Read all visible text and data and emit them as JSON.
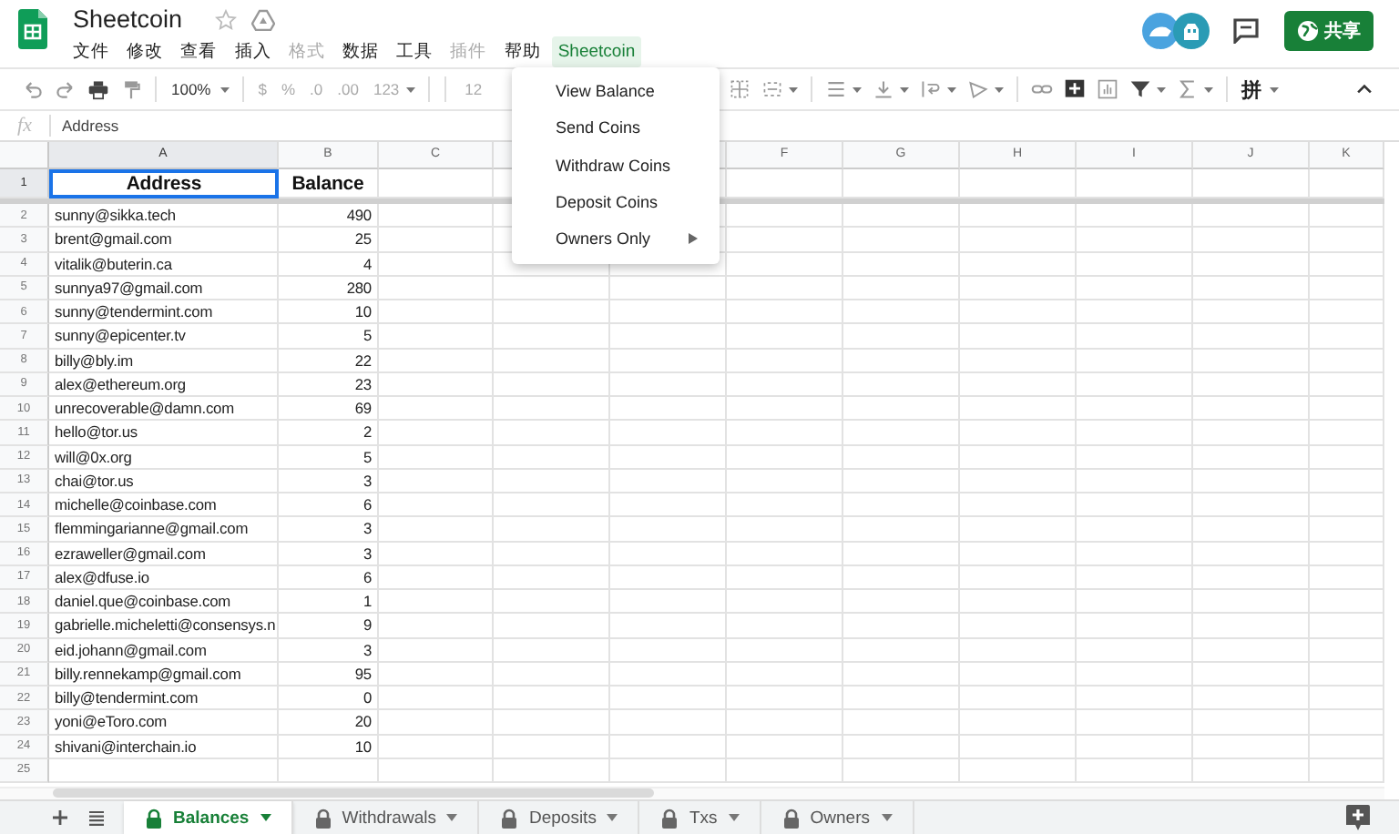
{
  "document": {
    "title": "Sheetcoin"
  },
  "menu_bar": [
    {
      "label": "文件",
      "disabled": false,
      "selected": false
    },
    {
      "label": "修改",
      "disabled": false,
      "selected": false
    },
    {
      "label": "查看",
      "disabled": false,
      "selected": false
    },
    {
      "label": "插入",
      "disabled": false,
      "selected": false
    },
    {
      "label": "格式",
      "disabled": true,
      "selected": false
    },
    {
      "label": "数据",
      "disabled": false,
      "selected": false
    },
    {
      "label": "工具",
      "disabled": false,
      "selected": false
    },
    {
      "label": "插件",
      "disabled": true,
      "selected": false
    },
    {
      "label": "帮助",
      "disabled": false,
      "selected": false
    },
    {
      "label": "Sheetcoin",
      "disabled": false,
      "selected": true
    }
  ],
  "share_button": {
    "label": "共享"
  },
  "toolbar": [
    {
      "text": "100%",
      "disabled": false
    },
    {
      "text": "$",
      "disabled": true
    },
    {
      "text": "%",
      "disabled": true
    },
    {
      "text": ".0",
      "disabled": true
    },
    {
      "text": ".00",
      "disabled": true
    },
    {
      "text": "123",
      "disabled": true
    },
    {
      "text": "12",
      "disabled": true
    },
    {
      "text": "拼",
      "disabled": false
    }
  ],
  "formula_bar": {
    "label": "fx",
    "value": "Address"
  },
  "sheet": {
    "columns": [
      {
        "label": "A",
        "selected": true
      },
      {
        "label": "B",
        "selected": false
      },
      {
        "label": "C",
        "selected": false
      },
      {
        "selected": false
      },
      {
        "selected": false
      },
      {
        "label": "F",
        "selected": false
      },
      {
        "label": "G",
        "selected": false
      },
      {
        "label": "H",
        "selected": false
      },
      {
        "label": "I",
        "selected": false
      },
      {
        "label": "J",
        "selected": false
      },
      {
        "label": "K",
        "selected": false
      }
    ],
    "rows": [
      {
        "number": "1",
        "kind": "header",
        "selected": true,
        "cells": [
          "Address",
          "Balance"
        ]
      },
      {
        "number": "2",
        "kind": "data",
        "selected": false,
        "cells": [
          "sunny@sikka.tech",
          "490"
        ]
      },
      {
        "number": "3",
        "kind": "data",
        "selected": false,
        "cells": [
          "brent@gmail.com",
          "25"
        ]
      },
      {
        "number": "4",
        "kind": "data",
        "selected": false,
        "cells": [
          "vitalik@buterin.ca",
          "4"
        ]
      },
      {
        "number": "5",
        "kind": "data",
        "selected": false,
        "cells": [
          "sunnya97@gmail.com",
          "280"
        ]
      },
      {
        "number": "6",
        "kind": "data",
        "selected": false,
        "cells": [
          "sunny@tendermint.com",
          "10"
        ]
      },
      {
        "number": "7",
        "kind": "data",
        "selected": false,
        "cells": [
          "sunny@epicenter.tv",
          "5"
        ]
      },
      {
        "number": "8",
        "kind": "data",
        "selected": false,
        "cells": [
          "billy@bly.im",
          "22"
        ]
      },
      {
        "number": "9",
        "kind": "data",
        "selected": false,
        "cells": [
          "alex@ethereum.org",
          "23"
        ]
      },
      {
        "number": "10",
        "kind": "data",
        "selected": false,
        "cells": [
          "unrecoverable@damn.com",
          "69"
        ]
      },
      {
        "number": "11",
        "kind": "data",
        "selected": false,
        "cells": [
          "hello@tor.us",
          "2"
        ]
      },
      {
        "number": "12",
        "kind": "data",
        "selected": false,
        "cells": [
          "will@0x.org",
          "5"
        ]
      },
      {
        "number": "13",
        "kind": "data",
        "selected": false,
        "cells": [
          "chai@tor.us",
          "3"
        ]
      },
      {
        "number": "14",
        "kind": "data",
        "selected": false,
        "cells": [
          "michelle@coinbase.com",
          "6"
        ]
      },
      {
        "number": "15",
        "kind": "data",
        "selected": false,
        "cells": [
          "flemmingarianne@gmail.com",
          "3"
        ]
      },
      {
        "number": "16",
        "kind": "data",
        "selected": false,
        "cells": [
          "ezraweller@gmail.com",
          "3"
        ]
      },
      {
        "number": "17",
        "kind": "data",
        "selected": false,
        "cells": [
          "alex@dfuse.io",
          "6"
        ]
      },
      {
        "number": "18",
        "kind": "data",
        "selected": false,
        "cells": [
          "daniel.que@coinbase.com",
          "1"
        ]
      },
      {
        "number": "19",
        "kind": "data",
        "selected": false,
        "cells": [
          "gabrielle.micheletti@consensys.n",
          "9"
        ]
      },
      {
        "number": "20",
        "kind": "data",
        "selected": false,
        "cells": [
          "eid.johann@gmail.com",
          "3"
        ]
      },
      {
        "number": "21",
        "kind": "data",
        "selected": false,
        "cells": [
          "billy.rennekamp@gmail.com",
          "95"
        ]
      },
      {
        "number": "22",
        "kind": "data",
        "selected": false,
        "cells": [
          "billy@tendermint.com",
          "0"
        ]
      },
      {
        "number": "23",
        "kind": "data",
        "selected": false,
        "cells": [
          "yoni@eToro.com",
          "20"
        ]
      },
      {
        "number": "24",
        "kind": "data",
        "selected": false,
        "cells": [
          "shivani@interchain.io",
          "10"
        ]
      },
      {
        "number": "25",
        "kind": "data",
        "selected": false,
        "cells": []
      }
    ]
  },
  "dropdown_menu": {
    "items": [
      {
        "label": "View Balance",
        "submenu": false
      },
      {
        "label": "Send Coins",
        "submenu": false
      },
      {
        "label": "Withdraw Coins",
        "submenu": false
      },
      {
        "label": "Deposit Coins",
        "submenu": false
      },
      {
        "label": "Owners Only",
        "submenu": true
      }
    ]
  },
  "sheet_tabs": [
    {
      "name": "Balances",
      "locked": true,
      "selected": true
    },
    {
      "name": "Withdrawals",
      "locked": true,
      "selected": false
    },
    {
      "name": "Deposits",
      "locked": true,
      "selected": false
    },
    {
      "name": "Txs",
      "locked": true,
      "selected": false
    },
    {
      "name": "Owners",
      "locked": true,
      "selected": false
    }
  ]
}
